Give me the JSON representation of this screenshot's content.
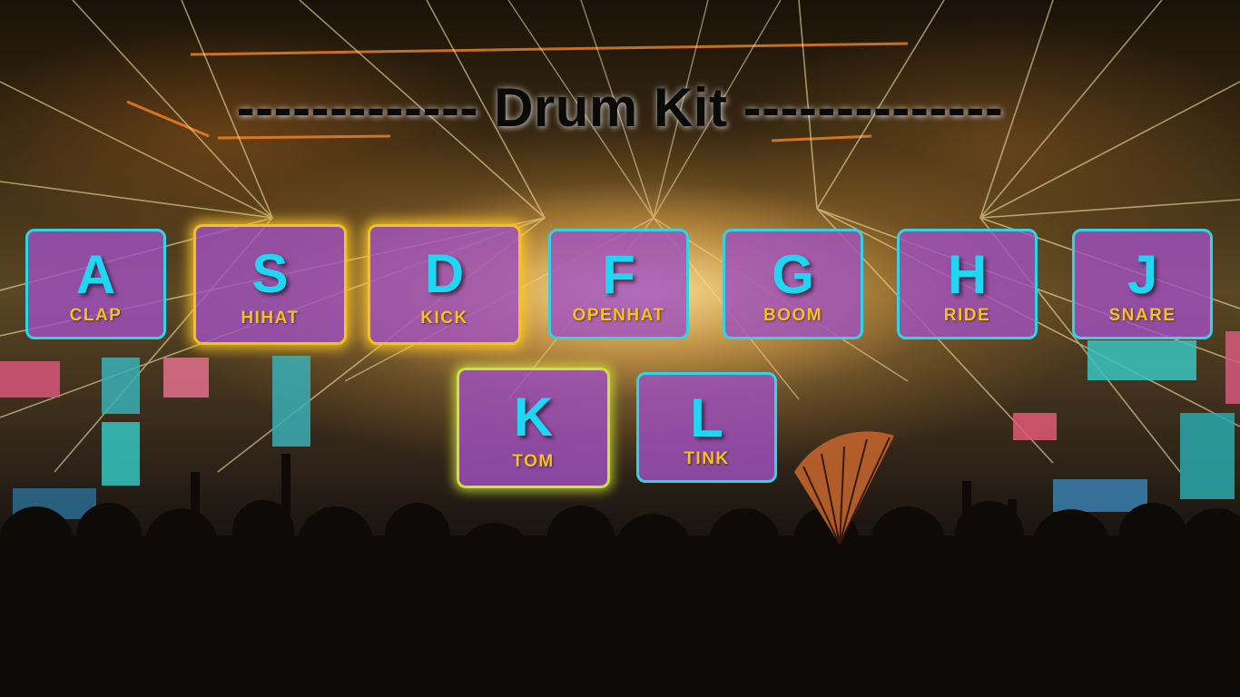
{
  "title": "------------- Drum Kit --------------",
  "pads": [
    {
      "key": "A",
      "sound": "CLAP"
    },
    {
      "key": "S",
      "sound": "HIHAT"
    },
    {
      "key": "D",
      "sound": "KICK"
    },
    {
      "key": "F",
      "sound": "OPENHAT"
    },
    {
      "key": "G",
      "sound": "BOOM"
    },
    {
      "key": "H",
      "sound": "RIDE"
    },
    {
      "key": "J",
      "sound": "SNARE"
    },
    {
      "key": "K",
      "sound": "TOM"
    },
    {
      "key": "L",
      "sound": "TINK"
    }
  ],
  "colors": {
    "pad_background": "#a050be",
    "pad_border": "#31d4e6",
    "pad_playing_border": "#f0c418",
    "key_text": "#20d6f2",
    "sound_text": "#f4c21a",
    "title_text": "#0a0a0a"
  },
  "background": {
    "description_icon": "concert-crowd-laser-photo"
  }
}
